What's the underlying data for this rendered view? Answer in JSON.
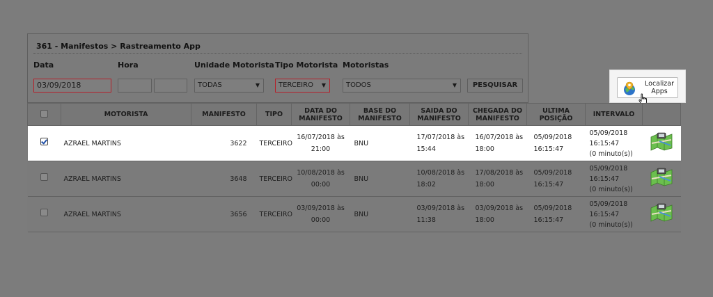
{
  "breadcrumb": "361 - Manifestos > Rastreamento App",
  "filters": {
    "data_label": "Data",
    "data_value": "03/09/2018",
    "hora_label": "Hora",
    "unidade_label": "Unidade Motorista",
    "unidade_value": "TODAS",
    "tipo_label": "Tipo Motorista",
    "tipo_value": "TERCEIRO",
    "motoristas_label": "Motoristas",
    "motoristas_value": "TODOS",
    "search_label": "PESQUISAR"
  },
  "localizar": {
    "label": "Localizar\nApps",
    "icon": "globe-pin-icon"
  },
  "table": {
    "headers": {
      "motorista": "MOTORISTA",
      "manifesto": "MANIFESTO",
      "tipo": "TIPO",
      "data": "DATA DO MANIFESTO",
      "base": "BASE DO MANIFESTO",
      "saida": "SAIDA DO MANIFESTO",
      "chegada": "CHEGADA DO MANIFESTO",
      "ultima": "ULTIMA POSIÇÃO",
      "intervalo": "INTERVALO"
    },
    "rows": [
      {
        "checked": true,
        "motorista": "AZRAEL MARTINS",
        "manifesto": "3622",
        "tipo": "TERCEIRO",
        "data_l1": "16/07/2018 às",
        "data_l2": "21:00",
        "base": "BNU",
        "saida_l1": "17/07/2018 às",
        "saida_l2": "15:44",
        "chegada_l1": "16/07/2018 às",
        "chegada_l2": "18:00",
        "ultima_l1": "05/09/2018",
        "ultima_l2": "16:15:47",
        "int_l1": "05/09/2018",
        "int_l2": "16:15:47",
        "int_l3": "(0 minuto(s))"
      },
      {
        "checked": false,
        "motorista": "AZRAEL MARTINS",
        "manifesto": "3648",
        "tipo": "TERCEIRO",
        "data_l1": "10/08/2018 às",
        "data_l2": "00:00",
        "base": "BNU",
        "saida_l1": "10/08/2018 às",
        "saida_l2": "18:02",
        "chegada_l1": "17/08/2018 às",
        "chegada_l2": "18:00",
        "ultima_l1": "05/09/2018",
        "ultima_l2": "16:15:47",
        "int_l1": "05/09/2018",
        "int_l2": "16:15:47",
        "int_l3": "(0 minuto(s))"
      },
      {
        "checked": false,
        "motorista": "AZRAEL MARTINS",
        "manifesto": "3656",
        "tipo": "TERCEIRO",
        "data_l1": "03/09/2018 às",
        "data_l2": "00:00",
        "base": "BNU",
        "saida_l1": "03/09/2018 às",
        "saida_l2": "11:38",
        "chegada_l1": "03/09/2018 às",
        "chegada_l2": "18:00",
        "ultima_l1": "05/09/2018",
        "ultima_l2": "16:15:47",
        "int_l1": "05/09/2018",
        "int_l2": "16:15:47",
        "int_l3": "(0 minuto(s))"
      }
    ]
  }
}
